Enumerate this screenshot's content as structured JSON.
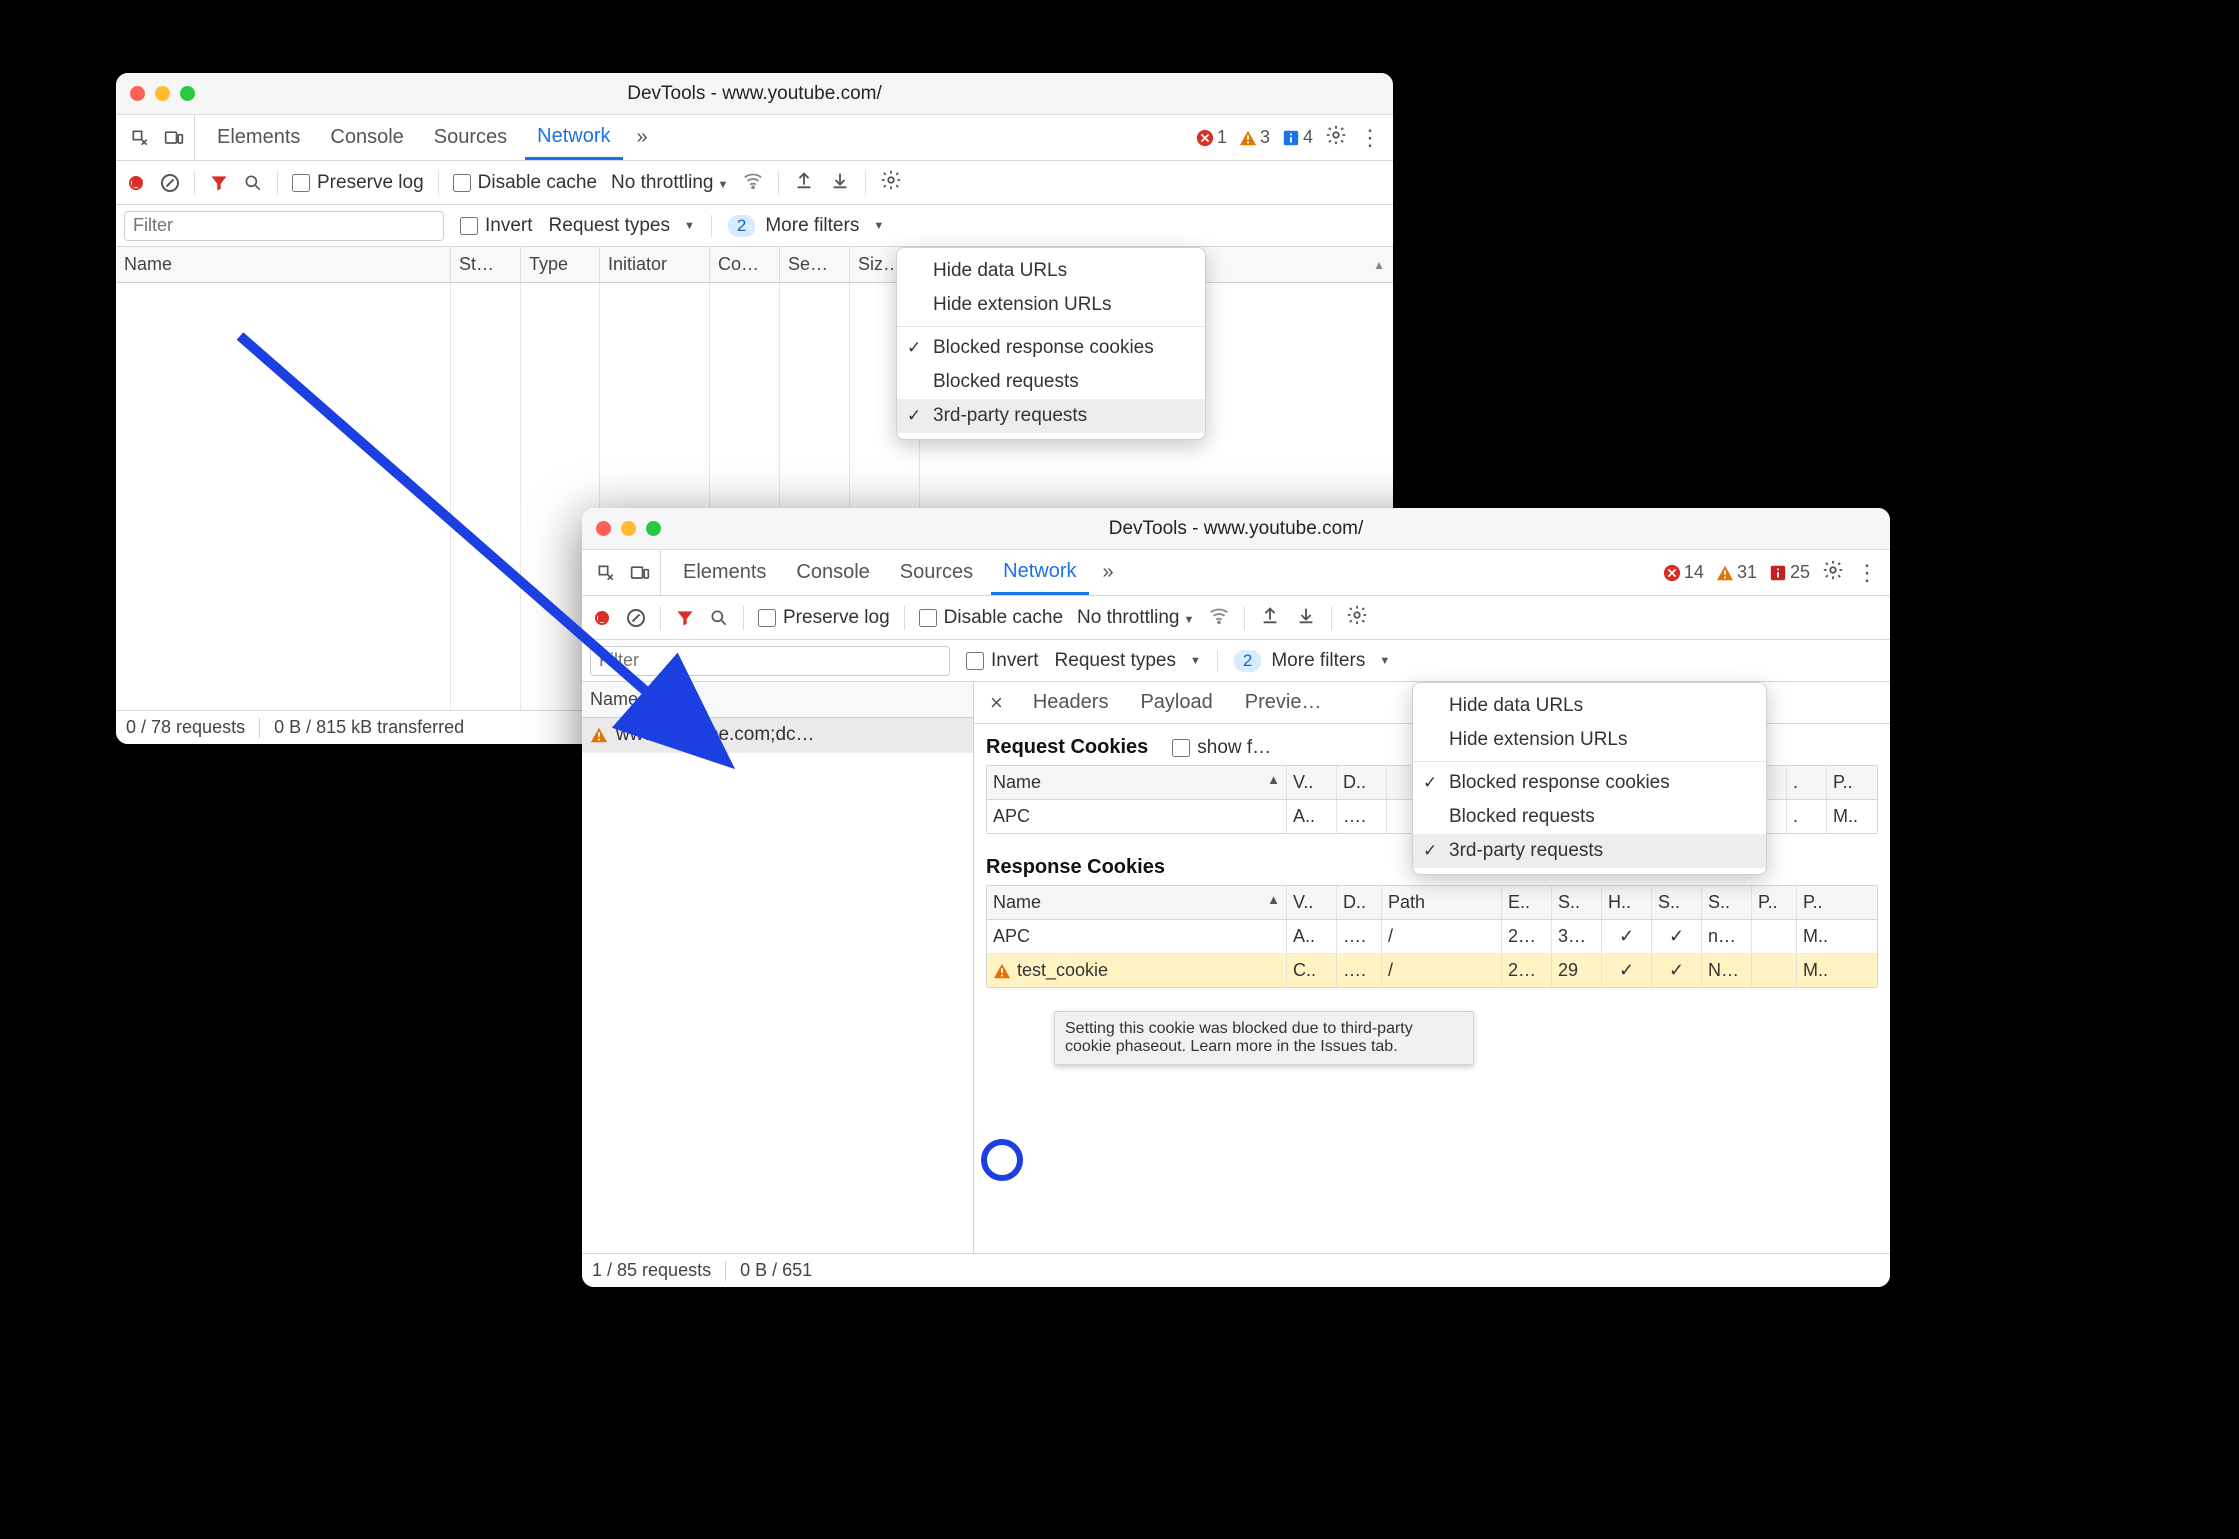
{
  "window1": {
    "title": "DevTools - www.youtube.com/",
    "tabs": {
      "elements": "Elements",
      "console": "Console",
      "sources": "Sources",
      "network": "Network"
    },
    "counts": {
      "errors": "1",
      "warnings": "3",
      "info": "4"
    },
    "toolbar": {
      "preserve": "Preserve log",
      "disable_cache": "Disable cache",
      "throttling": "No throttling"
    },
    "filterbar": {
      "placeholder": "Filter",
      "invert": "Invert",
      "request_types": "Request types",
      "more_filters": "More filters",
      "badge": "2"
    },
    "columns": [
      "Name",
      "St…",
      "Type",
      "Initiator",
      "Co…",
      "Se…",
      "Siz…"
    ],
    "menu": {
      "hide_data": "Hide data URLs",
      "hide_ext": "Hide extension URLs",
      "blocked_resp": "Blocked response cookies",
      "blocked_req": "Blocked requests",
      "third": "3rd-party requests"
    },
    "status": {
      "requests": "0 / 78 requests",
      "transferred": "0 B / 815 kB transferred"
    }
  },
  "window2": {
    "title": "DevTools - www.youtube.com/",
    "tabs": {
      "elements": "Elements",
      "console": "Console",
      "sources": "Sources",
      "network": "Network"
    },
    "counts": {
      "errors": "14",
      "warnings": "31",
      "info": "25"
    },
    "toolbar": {
      "preserve": "Preserve log",
      "disable_cache": "Disable cache",
      "throttling": "No throttling"
    },
    "filterbar": {
      "placeholder": "Filter",
      "invert": "Invert",
      "request_types": "Request types",
      "more_filters": "More filters",
      "badge": "2"
    },
    "menu": {
      "hide_data": "Hide data URLs",
      "hide_ext": "Hide extension URLs",
      "blocked_resp": "Blocked response cookies",
      "blocked_req": "Blocked requests",
      "third": "3rd-party requests"
    },
    "name_col": "Name",
    "request_row": "www.youtube.com;dc…",
    "detail_tabs": {
      "headers": "Headers",
      "payload": "Payload",
      "preview": "Previe…"
    },
    "request_cookies_title": "Request Cookies",
    "show_filtered": "show f…",
    "req_cookie_cols": [
      "Name",
      "V..",
      "D.."
    ],
    "req_cookie_trailing": [
      ".",
      "P.."
    ],
    "req_cookie_row": {
      "name": "APC",
      "v": "A..",
      "d": "…."
    },
    "req_cookie_row_trailing": [
      ".",
      "M.."
    ],
    "response_cookies_title": "Response Cookies",
    "resp_cookie_cols": [
      "Name",
      "V..",
      "D..",
      "Path",
      "E..",
      "S..",
      "H..",
      "S..",
      "S..",
      "P..",
      "P.."
    ],
    "resp_rows": [
      {
        "name": "APC",
        "v": "A..",
        "d": "….",
        "path": "/",
        "e": "2…",
        "s": "3…",
        "h": "✓",
        "s2": "✓",
        "s3": "n…",
        "p": "",
        "p2": "M.."
      },
      {
        "name": "test_cookie",
        "v": "C..",
        "d": "….",
        "path": "/",
        "e": "2…",
        "s": "29",
        "h": "✓",
        "s2": "✓",
        "s3": "N…",
        "p": "",
        "p2": "M.."
      }
    ],
    "tooltip": "Setting this cookie was blocked due to third-party cookie phaseout. Learn more in the Issues tab.",
    "status": {
      "requests": "1 / 85 requests",
      "transferred": "0 B / 651"
    }
  }
}
